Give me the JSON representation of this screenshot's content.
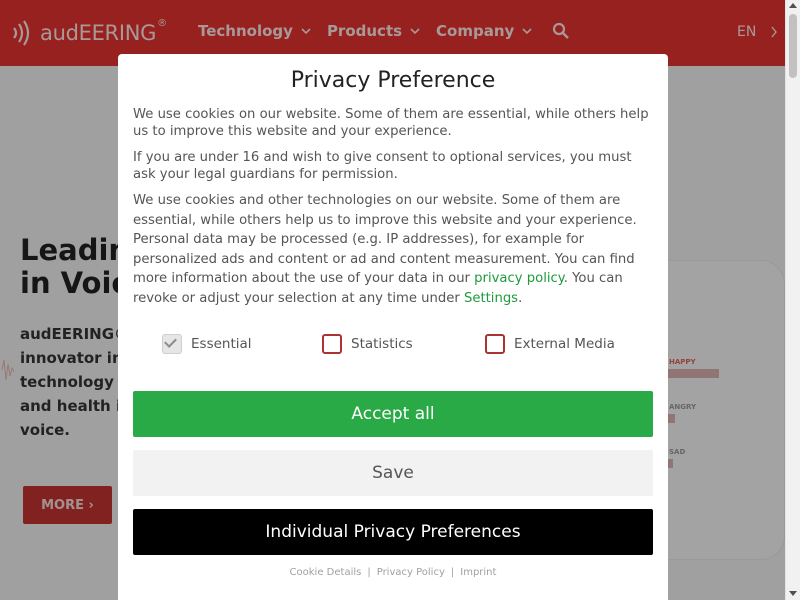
{
  "header": {
    "logo_text": "audEERING",
    "logo_reg": "®",
    "nav": [
      {
        "label": "Technology"
      },
      {
        "label": "Products"
      },
      {
        "label": "Company"
      }
    ],
    "lang": "EN",
    "brand_color": "#e0322e"
  },
  "hero": {
    "title_line1": "Leading",
    "title_line2": "in Voice",
    "text_lines": [
      "audEERING® i",
      "innovator in V",
      "technology ca",
      "and health inf",
      "voice."
    ],
    "more_button": "MORE ›",
    "phone_labels": [
      "HAPPY",
      "ANGRY",
      "SAD"
    ]
  },
  "modal": {
    "title": "Privacy Preference",
    "p1": "We use cookies on our website. Some of them are essential, while others help us to improve this website and your experience.",
    "p2": "If you are under 16 and wish to give consent to optional services, you must ask your legal guardians for permission.",
    "p3_before_link": "We use cookies and other technologies on our website. Some of them are essential, while others help us to improve this website and your experience. Personal data may be processed (e.g. IP addresses), for example for personalized ads and content or ad and content measurement. You can find more information about the use of your data in our ",
    "p3_link": "privacy policy",
    "p3_middle": ". You can revoke or adjust your selection at any time under ",
    "p3_settings": "Settings",
    "p3_end": ".",
    "consents": [
      {
        "label": "Essential",
        "checked": true,
        "disabled": true
      },
      {
        "label": "Statistics",
        "checked": false
      },
      {
        "label": "External Media",
        "checked": false
      }
    ],
    "buttons": {
      "accept_all": "Accept all",
      "save": "Save",
      "individual": "Individual Privacy Preferences"
    },
    "footer_links": [
      "Cookie Details",
      "Privacy Policy",
      "Imprint"
    ],
    "footer_sep": "|",
    "accept_color": "#2aaa46"
  }
}
